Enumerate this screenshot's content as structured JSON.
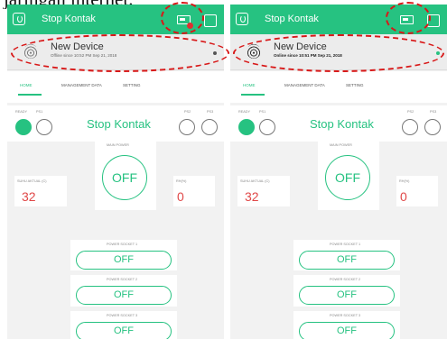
{
  "caption": "jaringan internet.",
  "colors": {
    "accent": "#26c281",
    "appbar": "#26c281",
    "value": "#e04848",
    "annotation": "#d81818"
  },
  "icons": {
    "power": "power-icon",
    "battery": "battery-icon",
    "fingerprint": "fingerprint-icon",
    "window": "square-icon"
  },
  "screens": [
    {
      "app_title": "Stop Kontak",
      "device_name": "New Device",
      "device_status": "Offline since 10:52 PM Sep 21, 2018",
      "tabs": [
        "HOME",
        "MANAGEMENT DATA",
        "SETTING"
      ],
      "labels": {
        "ready": "READY",
        "p1": "PS1",
        "p2": "PS2",
        "p3": "PS3",
        "main_power": "MAIN POWER",
        "suhu": "SUHU AKTUAL (C)",
        "rh": "RH(%)"
      },
      "widget_title": "Stop Kontak",
      "main_power_state": "OFF",
      "suhu_value": "32",
      "rh_value": "0",
      "sockets": [
        {
          "label": "POWER SOCKET 1",
          "state": "OFF"
        },
        {
          "label": "POWER SOCKET 2",
          "state": "OFF"
        },
        {
          "label": "POWER SOCKET 3",
          "state": "OFF"
        }
      ]
    },
    {
      "app_title": "Stop Kontak",
      "device_name": "New Device",
      "device_status": "Online since 10:51 PM Sep 21, 2018",
      "tabs": [
        "HOME",
        "MANAGEMENT DATA",
        "SETTING"
      ],
      "labels": {
        "ready": "READY",
        "p1": "PS1",
        "p2": "PS2",
        "p3": "PS3",
        "main_power": "MAIN POWER",
        "suhu": "SUHU AKTUAL (C)",
        "rh": "RH(%)"
      },
      "widget_title": "Stop Kontak",
      "main_power_state": "OFF",
      "suhu_value": "32",
      "rh_value": "0",
      "sockets": [
        {
          "label": "POWER SOCKET 1",
          "state": "OFF"
        },
        {
          "label": "POWER SOCKET 2",
          "state": "OFF"
        },
        {
          "label": "POWER SOCKET 3",
          "state": "OFF"
        }
      ]
    }
  ]
}
